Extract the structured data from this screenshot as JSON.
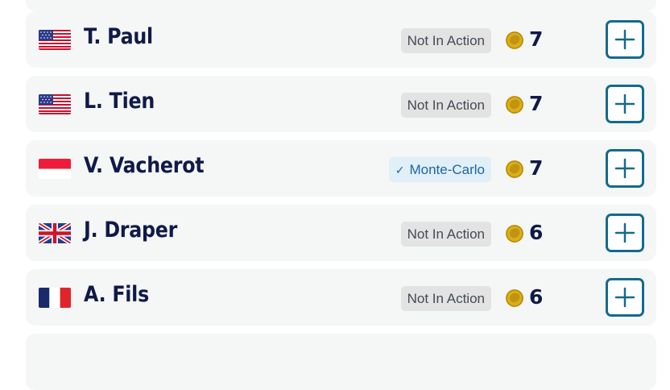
{
  "players": [
    {
      "name": "T. Paul",
      "flag": "usa-flag-icon",
      "status": "Not In Action",
      "status_active": false,
      "points": "7"
    },
    {
      "name": "L. Tien",
      "flag": "usa-flag-icon",
      "status": "Not In Action",
      "status_active": false,
      "points": "7"
    },
    {
      "name": "V. Vacherot",
      "flag": "monaco-flag-icon",
      "status": "Monte-Carlo",
      "status_active": true,
      "points": "7"
    },
    {
      "name": "J. Draper",
      "flag": "uk-flag-icon",
      "status": "Not In Action",
      "status_active": false,
      "points": "6"
    },
    {
      "name": "A. Fils",
      "flag": "france-flag-icon",
      "status": "Not In Action",
      "status_active": false,
      "points": "6"
    }
  ],
  "colors": {
    "name_text": "#101a48",
    "add_button_border": "#146a8e",
    "active_status_bg": "#e1eff8",
    "active_status_text": "#1c66a5",
    "inactive_status_bg": "#e3e3e3",
    "coin": "#d9ae1a"
  },
  "icons": {
    "coin": "coin-icon",
    "add": "plus-icon",
    "check": "checkmark-icon"
  }
}
